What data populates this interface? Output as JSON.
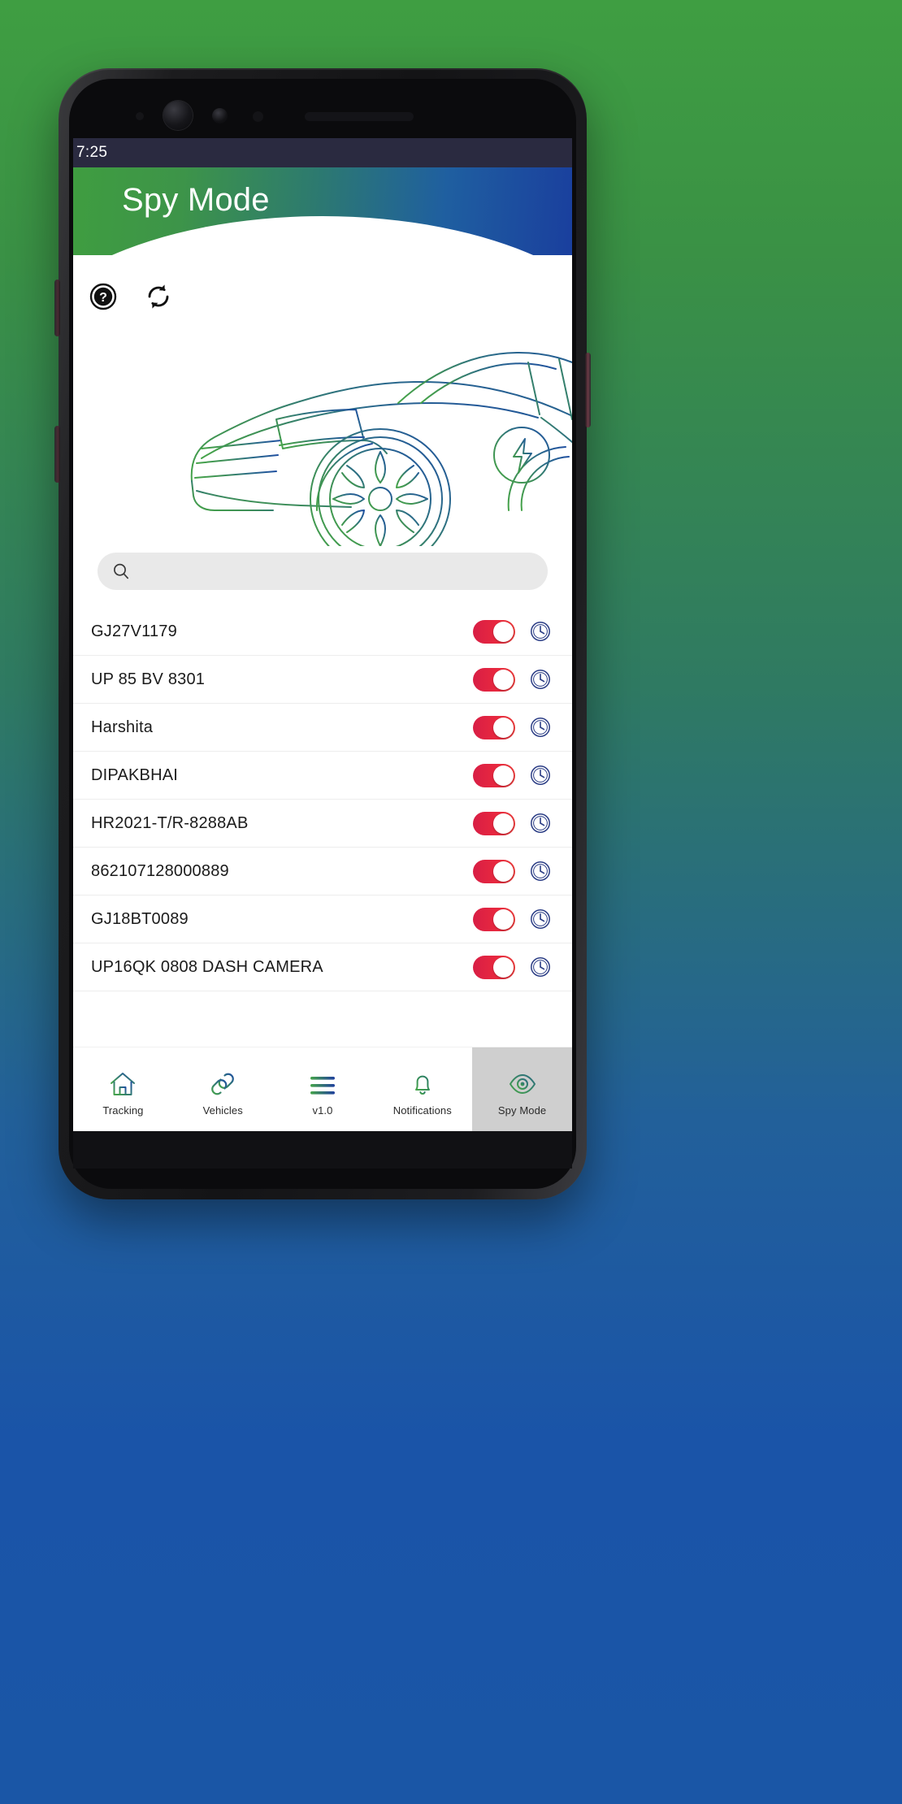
{
  "status_bar": {
    "time": "7:25"
  },
  "header": {
    "title": "Spy Mode"
  },
  "actions": {
    "help": {
      "name": "help-icon",
      "label": "?"
    },
    "refresh": {
      "name": "refresh-icon",
      "label": "Refresh"
    }
  },
  "illustration": {
    "name": "car-line-art",
    "badge": "lightning-bolt"
  },
  "search": {
    "value": "",
    "placeholder": ""
  },
  "list": {
    "rows": [
      {
        "label": "GJ27V1179",
        "toggle_on": true,
        "clock": "clock-icon"
      },
      {
        "label": "UP 85 BV 8301",
        "toggle_on": true,
        "clock": "clock-icon"
      },
      {
        "label": "Harshita",
        "toggle_on": true,
        "clock": "clock-icon"
      },
      {
        "label": "DIPAKBHAI",
        "toggle_on": true,
        "clock": "clock-icon"
      },
      {
        "label": "HR2021-T/R-8288AB",
        "toggle_on": true,
        "clock": "clock-icon"
      },
      {
        "label": "862107128000889",
        "toggle_on": true,
        "clock": "clock-icon"
      },
      {
        "label": "GJ18BT0089",
        "toggle_on": true,
        "clock": "clock-icon"
      },
      {
        "label": "UP16QK 0808 DASH CAMERA",
        "toggle_on": true,
        "clock": "clock-icon"
      }
    ]
  },
  "bottom_nav": {
    "items": [
      {
        "label": "Tracking",
        "icon": "home-icon",
        "active": false
      },
      {
        "label": "Vehicles",
        "icon": "link-icon",
        "active": false
      },
      {
        "label": "v1.0",
        "icon": "menu-icon",
        "active": false
      },
      {
        "label": "Notifications",
        "icon": "bell-icon",
        "active": false
      },
      {
        "label": "Spy Mode",
        "icon": "eye-icon",
        "active": true
      }
    ]
  },
  "colors": {
    "brand_green": "#3f9d40",
    "brand_blue": "#1a3f9e",
    "toggle_on": "#e8283f",
    "status_bar": "#2a2a40",
    "search_bg": "#e9e9e9",
    "active_nav_bg": "#cfcfcf"
  }
}
